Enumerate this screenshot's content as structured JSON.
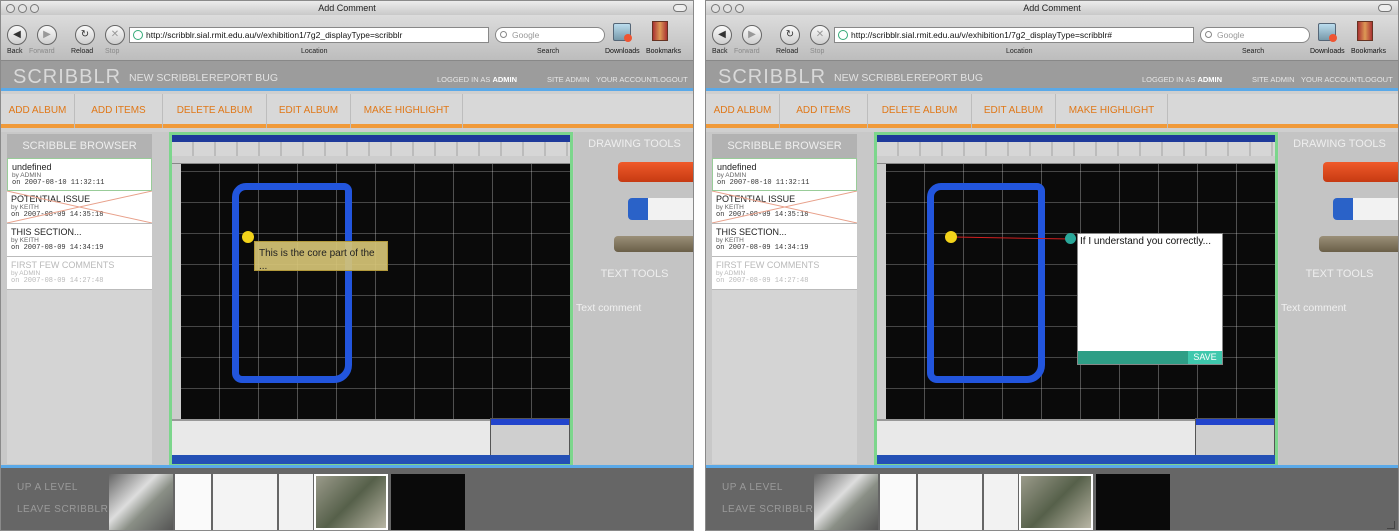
{
  "windows": [
    {
      "window_title": "Add Comment",
      "nav": {
        "back": "Back",
        "forward": "Forward",
        "reload": "Reload",
        "stop": "Stop"
      },
      "url": "http://scribblr.sial.rmit.edu.au/v/exhibition1/7g2_displayType=scribblr",
      "location_label": "Location",
      "search_placeholder": "Google",
      "search_label": "Search",
      "downloads_label": "Downloads",
      "bookmarks_label": "Bookmarks",
      "app": {
        "logo": "SCRIBBLR",
        "new_scribble": "NEW SCRIBBLE",
        "report_bug": "REPORT BUG",
        "logged_in_as": "LOGGED IN AS",
        "username": "ADMIN",
        "site_admin": "SITE ADMIN",
        "your_account": "YOUR ACCOUNT",
        "logout": "LOGOUT"
      },
      "actions": [
        "ADD ALBUM",
        "ADD ITEMS",
        "DELETE ALBUM",
        "EDIT ALBUM",
        "MAKE HIGHLIGHT"
      ],
      "browser_title": "SCRIBBLE BROWSER",
      "items": [
        {
          "title": "undefined",
          "by": "by ADMIN",
          "date": "on 2007-08-10 11:32:11"
        },
        {
          "title": "POTENTIAL ISSUE",
          "by": "by KEITH",
          "date": "on 2007-08-09 14:35:18"
        },
        {
          "title": "THIS SECTION...",
          "by": "by KEITH",
          "date": "on 2007-08-09 14:34:19"
        },
        {
          "title": "FIRST FEW COMMENTS",
          "by": "by ADMIN",
          "date": "on 2007-08-09 14:27:48"
        }
      ],
      "drawing_tools": "DRAWING TOOLS",
      "text_tools": "TEXT TOOLS",
      "text_comment": "Text comment",
      "comment_text": "This is the core part of the ...",
      "up_a_level": "UP A LEVEL",
      "leave_scribblr": "LEAVE SCRIBBLR"
    },
    {
      "window_title": "Add Comment",
      "nav": {
        "back": "Back",
        "forward": "Forward",
        "reload": "Reload",
        "stop": "Stop"
      },
      "url": "http://scribblr.sial.rmit.edu.au/v/exhibition1/7g2_displayType=scribblr#",
      "location_label": "Location",
      "search_placeholder": "Google",
      "search_label": "Search",
      "downloads_label": "Downloads",
      "bookmarks_label": "Bookmarks",
      "app": {
        "logo": "SCRIBBLR",
        "new_scribble": "NEW SCRIBBLE",
        "report_bug": "REPORT BUG",
        "logged_in_as": "LOGGED IN AS",
        "username": "ADMIN",
        "site_admin": "SITE ADMIN",
        "your_account": "YOUR ACCOUNT",
        "logout": "LOGOUT"
      },
      "actions": [
        "ADD ALBUM",
        "ADD ITEMS",
        "DELETE ALBUM",
        "EDIT ALBUM",
        "MAKE HIGHLIGHT"
      ],
      "browser_title": "SCRIBBLE BROWSER",
      "items": [
        {
          "title": "undefined",
          "by": "by ADMIN",
          "date": "on 2007-08-10 11:32:11"
        },
        {
          "title": "POTENTIAL ISSUE",
          "by": "by KEITH",
          "date": "on 2007-08-09 14:35:18"
        },
        {
          "title": "THIS SECTION...",
          "by": "by KEITH",
          "date": "on 2007-08-09 14:34:19"
        },
        {
          "title": "FIRST FEW COMMENTS",
          "by": "by ADMIN",
          "date": "on 2007-08-09 14:27:48"
        }
      ],
      "drawing_tools": "DRAWING TOOLS",
      "text_tools": "TEXT TOOLS",
      "text_comment": "Text comment",
      "comment_text": "If I understand you correctly...",
      "save_label": "SAVE",
      "up_a_level": "UP A LEVEL",
      "leave_scribblr": "LEAVE SCRIBBLR"
    }
  ],
  "colors": {
    "accent_orange": "#e07818",
    "accent_blue": "#5aa9e8",
    "canvas_border": "#7cd68c",
    "scribble_blue": "#2255dd",
    "save_teal": "#3fc8ad"
  }
}
